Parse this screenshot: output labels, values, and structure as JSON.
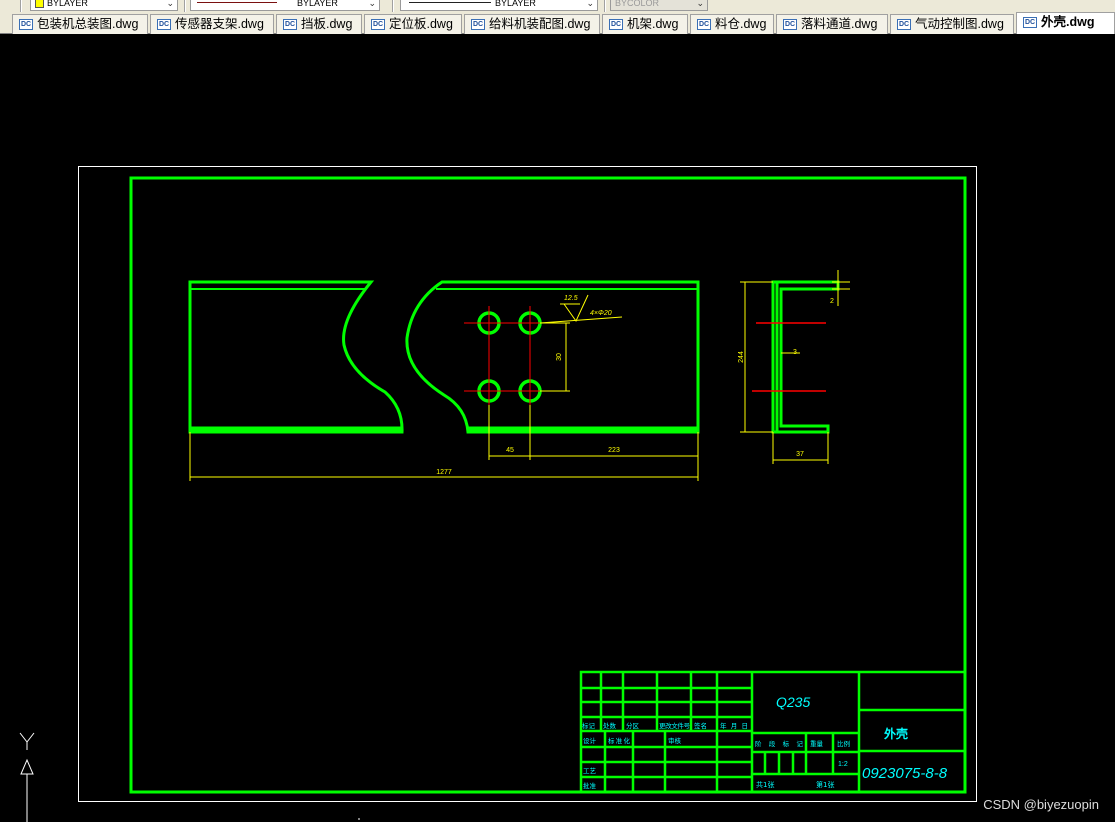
{
  "toolbar": {
    "color_value": "BYLAYER",
    "linetype_value": "BYLAYER",
    "lineweight_value": "BYLAYER",
    "plotstyle_value": "BYCOLOR"
  },
  "tabs": [
    {
      "label": "包装机总装图.dwg",
      "active": false
    },
    {
      "label": "传感器支架.dwg",
      "active": false
    },
    {
      "label": "挡板.dwg",
      "active": false
    },
    {
      "label": "定位板.dwg",
      "active": false
    },
    {
      "label": "给料机装配图.dwg",
      "active": false
    },
    {
      "label": "机架.dwg",
      "active": false
    },
    {
      "label": "料仓.dwg",
      "active": false
    },
    {
      "label": "落料通道.dwg",
      "active": false
    },
    {
      "label": "气动控制图.dwg",
      "active": false
    },
    {
      "label": "外壳.dwg",
      "active": true
    }
  ],
  "tab_icon_text": "DC",
  "drawing": {
    "dimensions": {
      "overall_length": "1277",
      "hole_spacing": "45",
      "right_offset": "223",
      "hole_vertical": "30",
      "side_height": "244",
      "side_width": "37",
      "side_small": "3",
      "flange": "2",
      "roughness": "12.5",
      "hole_callout": "4×Φ20"
    },
    "title_block": {
      "material": "Q235",
      "part_name": "外壳",
      "drawing_number": "0923075-8-8",
      "scale": "1:2",
      "sheet_total": "共1张",
      "sheet_index": "第1张",
      "head_labels": [
        "标记",
        "处数",
        "分区",
        "更改文件号",
        "签名",
        "年月日"
      ],
      "row_labels": [
        "设计",
        "标准化",
        "审核",
        "工艺",
        "批准"
      ],
      "right_labels": [
        "阶段标记",
        "重量",
        "比例"
      ]
    }
  },
  "watermark": "CSDN @biyezuopin",
  "colors": {
    "frame_green": "#00ff00",
    "dim_yellow": "#ffff00",
    "center_red": "#ff0000",
    "text_cyan": "#00ffff",
    "white": "#ffffff"
  }
}
